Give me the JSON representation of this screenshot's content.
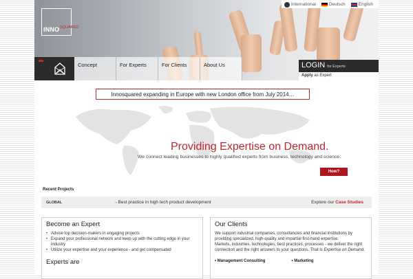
{
  "logo": {
    "text": "INNO",
    "sup": "SQUARED"
  },
  "languages": [
    {
      "label": "International",
      "icon": "globe-icon"
    },
    {
      "label": "Deutsch",
      "icon": "flag-de-icon"
    },
    {
      "label": "English",
      "icon": "flag-uk-icon"
    }
  ],
  "nav": {
    "items": [
      "Concept",
      "For Experts",
      "For Clients",
      "About Us"
    ]
  },
  "login": {
    "title": "LOGIN",
    "sub": "for Experts",
    "apply_bold": "Apply",
    "apply_rest": " as Expert"
  },
  "announcement": "Innosquared expanding in Europe with new London office from July 2014…",
  "hero": {
    "tagline": "Providing Expertise on Demand.",
    "subtagline": "We connect leading businesses to highly qualified experts from business, technology and science.",
    "cta": "How?"
  },
  "projects": {
    "label": "Recent Projects",
    "region": "GLOBAL",
    "item": "Best practice in high tech product development",
    "explore_prefix": "Explore our ",
    "explore_link": "Case Studies"
  },
  "expert_card": {
    "title": "Become an Expert",
    "bullets": [
      "Advise top decision-makers in engaging projects",
      "Expand your professional network and keep up with the cutting edge in your industry",
      "Utilize your expertise and your experience - and get compensated"
    ],
    "subtitle": "Experts are"
  },
  "clients_card": {
    "title": "Our Clients",
    "text1": "We support industrial companies, consultancies and financial institutions by providing specialized, high-quality and impartial first-hand expertise.",
    "text2": "Markets, industries, technologies, best practices, processes - we deliver the right connection and the right answers to your questions. That is ",
    "text2_em": "Expertise on Demand",
    "text2_end": ".",
    "col1": "Management Consulting",
    "col2": "Marketing"
  },
  "colors": {
    "accent": "#c0262d",
    "nav_dark": "#2b2b2b"
  }
}
